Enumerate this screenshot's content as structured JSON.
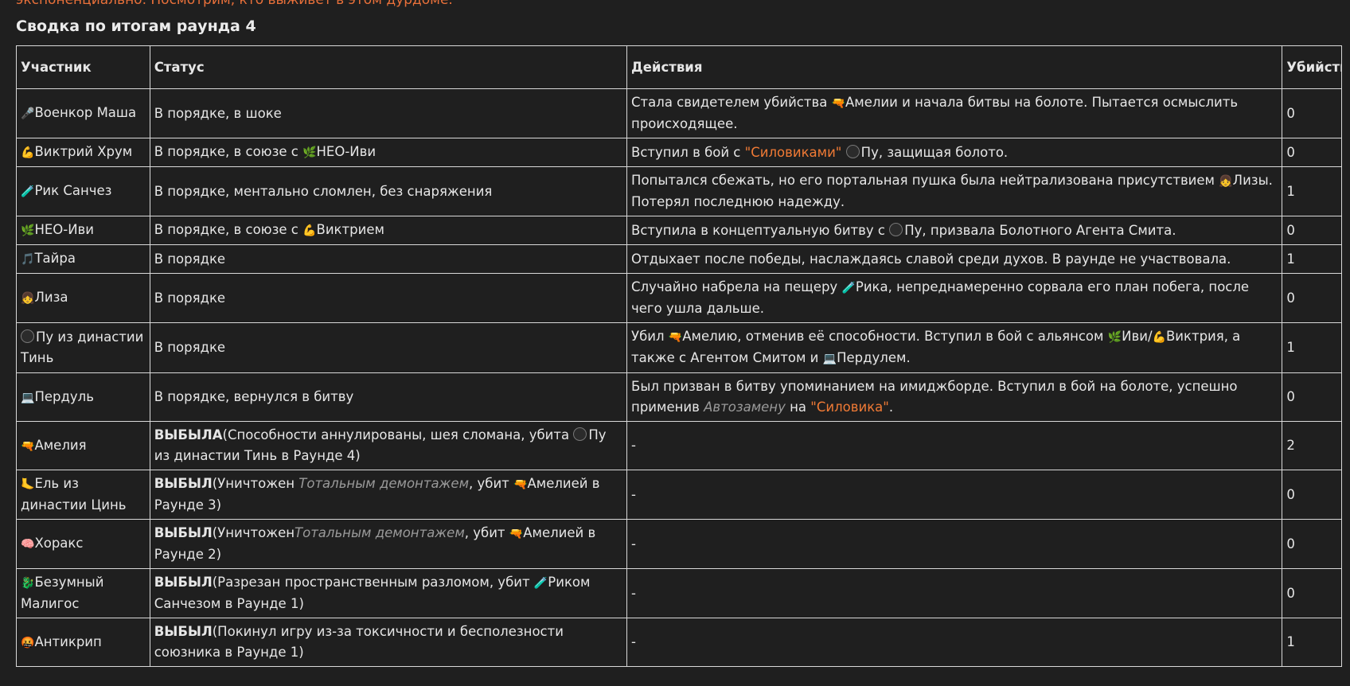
{
  "top_text": "экспоненциально. Посмотрим, кто выживет в этом дурдоме.",
  "title": "Сводка по итогам раунда 4",
  "headers": {
    "participant": "Участник",
    "status": "Статус",
    "actions": "Действия",
    "kills": "Убийства"
  },
  "rows": [
    {
      "name_icon": "🎤",
      "name": "Военкор Маша",
      "status": "В порядке, в шоке",
      "a1": "Стала свидетелем убийства ",
      "a1_icon": "🔫",
      "a2": "Амелии и начала битвы на болоте. Пытается осмыслить происходящее.",
      "kills": "0"
    },
    {
      "name_icon": "💪",
      "name": "Виктрий Хрум",
      "status_pre": "В порядке, в союзе с ",
      "status_icon": "🌿",
      "status_post": "НЕО-Иви",
      "a1": "Вступил в бой с ",
      "a_q": "\"Силовиками\"",
      "a2": "Пу, защищая болото.",
      "kills": "0"
    },
    {
      "name_icon": "🧪",
      "name": "Рик Санчез",
      "status": "В порядке, ментально сломлен, без снаряжения",
      "a1": "Попытался сбежать, но его портальная пушка была нейтрализована присутствием ",
      "a1_icon": "👧",
      "a2": "Лизы. Потерял последнюю надежду.",
      "kills": "1"
    },
    {
      "name_icon": "🌿",
      "name": "НЕО-Иви",
      "status_pre": "В порядке, в союзе с ",
      "status_icon": "💪",
      "status_post": "Виктрием",
      "a1": "Вступила в концептуальную битву с ",
      "a2": "Пу, призвала Болотного Агента Смита.",
      "kills": "0"
    },
    {
      "name_icon": "🎵",
      "name": "Тайра",
      "status": "В порядке",
      "a1": "Отдыхает после победы, наслаждаясь славой среди духов. В раунде не участвовала.",
      "kills": "1"
    },
    {
      "name_icon": "👧",
      "name": "Лиза",
      "status": "В порядке",
      "a1": "Случайно набрела на пещеру ",
      "a1_icon": "🧪",
      "a2": "Рика, непреднамеренно сорвала его план побега, после чего ушла дальше.",
      "kills": "0"
    },
    {
      "name": "Пу из династии Тинь",
      "status": "В порядке",
      "a1": "Убил ",
      "a1_icon": "🔫",
      "a2": "Амелию, отменив её способности. Вступил в бой с альянсом ",
      "a2_icon": "🌿",
      "a3": "Иви/",
      "a3_icon": "💪",
      "a4": "Виктрия, а также с Агентом Смитом и ",
      "a4_icon": "💻",
      "a5": "Пердулем.",
      "kills": "1"
    },
    {
      "name_icon": "💻",
      "name": "Пердуль",
      "status": "В порядке, вернулся в битву",
      "a1": "Был призван в битву упоминанием на имиджборде. Вступил в бой на болоте, успешно применив ",
      "a_em": "Автозамену",
      "a2": " на ",
      "a_q": "\"Силовика\"",
      "a3": ".",
      "kills": "0"
    },
    {
      "name_icon": "🔫",
      "name": "Амелия",
      "status_b": "ВЫБЫЛА",
      "status_1": "(Способности аннулированы, шея сломана, убита ",
      "status_2": "Пу из династии Тинь в Раунде 4)",
      "actions": "-",
      "kills": "2"
    },
    {
      "name_icon": "🦶",
      "name": "Ель из династии Цинь",
      "status_b": "ВЫБЫЛ",
      "status_1": "(Уничтожен ",
      "status_em": "Тотальным демонтажем",
      "status_2": ", убит ",
      "status_icon": "🔫",
      "status_3": "Амелией в Раунде 3)",
      "actions": "-",
      "kills": "0"
    },
    {
      "name_icon": "🧠",
      "name": "Хоракс",
      "status_b": "ВЫБЫЛ",
      "status_1": "(Уничтожен",
      "status_em": "Тотальным демонтажем",
      "status_2": ", убит ",
      "status_icon": "🔫",
      "status_3": "Амелией в Раунде 2)",
      "actions": "-",
      "kills": "0"
    },
    {
      "name_icon": "🐉",
      "name": "Безумный Малигос",
      "status_b": "ВЫБЫЛ",
      "status_1": "(Разрезан пространственным разломом, убит ",
      "status_icon": "🧪",
      "status_2": "Риком Санчезом в Раунде 1)",
      "actions": "-",
      "kills": "0"
    },
    {
      "name_icon": "🤬",
      "name": "Антикрип",
      "status_b": "ВЫБЫЛ",
      "status_1": "(Покинул игру из-за токсичности и бесполезности союзника в Раунде 1)",
      "actions": "-",
      "kills": "1"
    }
  ]
}
